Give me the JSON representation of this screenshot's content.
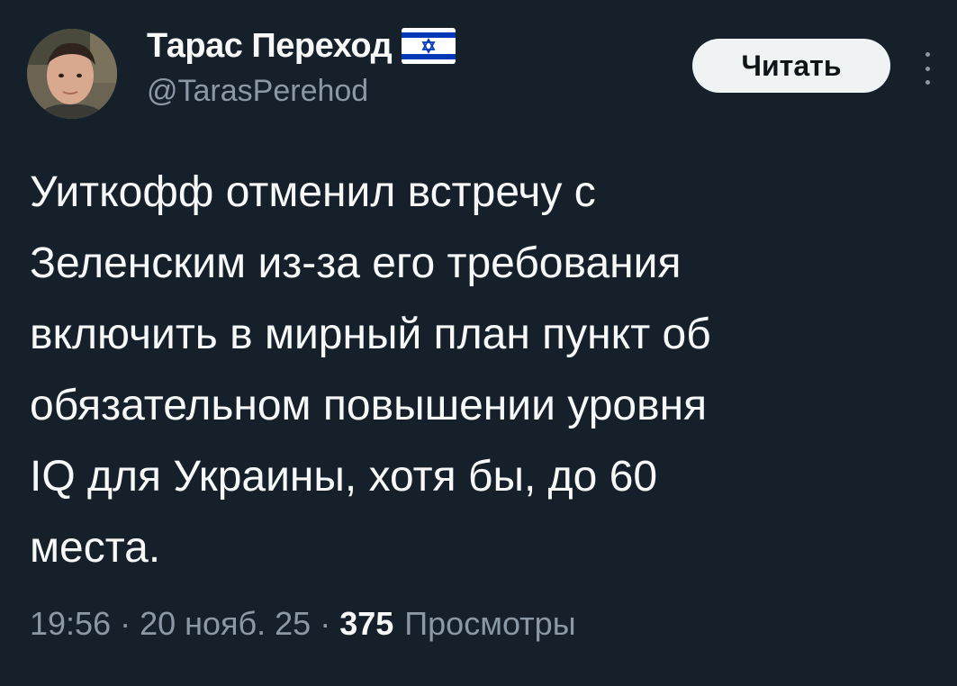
{
  "author": {
    "display_name": "Тарас Переход",
    "handle": "@TarasPerehod",
    "flag_icon": "israel-flag-icon",
    "avatar_icon": "profile-photo"
  },
  "follow_button": {
    "label": "Читать"
  },
  "more_icon": "more-vertical-icon",
  "tweet": {
    "text": "Уиткофф отменил встречу с\nЗеленским из-за его требования\nвключить в мирный план пункт об\nобязательном повышении уровня\nIQ для Украины, хотя бы, до 60\nместа."
  },
  "meta": {
    "time": "19:56",
    "separator": "·",
    "date": "20 нояб. 25",
    "views_count": "375",
    "views_label": "Просмотры"
  },
  "colors": {
    "background": "#15202b",
    "primary_text": "#f7f9f9",
    "secondary_text": "#8b98a5",
    "button_bg": "#eff3f4",
    "flag_blue": "#0038b8"
  }
}
